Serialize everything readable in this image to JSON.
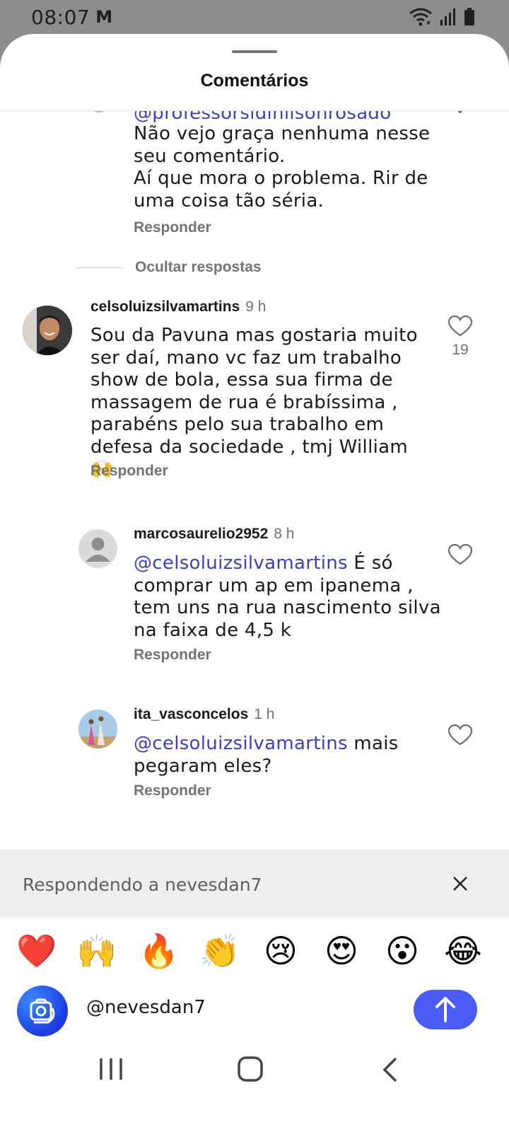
{
  "status_bar": {
    "time": "08:07",
    "mail_icon": "M"
  },
  "sheet": {
    "title": "Comentários"
  },
  "partial_comment": {
    "mention": "@professorsidinilsonrosado",
    "lines": [
      "Não vejo graça nenhuma nesse",
      "seu comentário.",
      "Aí que mora o problema.  Rir de",
      "uma coisa tão séria."
    ],
    "reply_label": "Responder"
  },
  "hide_replies_label": "Ocultar respostas",
  "comments": [
    {
      "username": "celsoluizsilvamartins",
      "time": "9 h",
      "lines": [
        "Sou da Pavuna mas gostaria muito",
        "ser daí, mano vc faz um trabalho",
        "show de bola,  essa sua firma de",
        "massagem de rua é brabíssima ,",
        "parabéns pelo sua trabalho em",
        "defesa da sociedade , tmj William 🙌"
      ],
      "likes": "19",
      "reply_label": "Responder"
    },
    {
      "username": "marcosaurelio2952",
      "time": "8 h",
      "mention": "@celsoluizsilvamartins",
      "lines": [
        " É só",
        "comprar um ap em ipanema ,",
        "tem uns na rua nascimento silva",
        "na faixa de 4,5 k"
      ],
      "reply_label": "Responder"
    },
    {
      "username": "ita_vasconcelos",
      "time": "1 h",
      "mention": "@celsoluizsilvamartins",
      "lines": [
        " mais",
        "pegaram eles?"
      ],
      "reply_label": "Responder"
    }
  ],
  "replying": {
    "text": "Respondendo a nevesdan7"
  },
  "emojis": [
    "❤️",
    "🙌",
    "🔥",
    "👏",
    "😢",
    "😍",
    "😮",
    "😂"
  ],
  "input": {
    "value": "@nevesdan7"
  },
  "colors": {
    "mention": "#3b3fc6",
    "send": "#4a5cf5",
    "muted": "#737373"
  }
}
